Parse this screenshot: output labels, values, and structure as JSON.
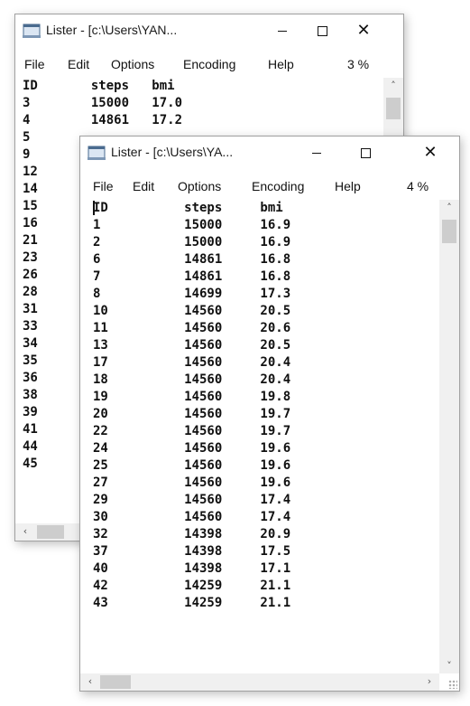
{
  "back_window": {
    "title": "Lister - [c:\\Users\\YAN...",
    "menu": {
      "file": "File",
      "edit": "Edit",
      "options": "Options",
      "encoding": "Encoding",
      "help": "Help",
      "percent": "3 %"
    },
    "text": "ID       steps   bmi\n3        15000   17.0\n4        14861   17.2\n5\n9\n12\n14\n15\n16\n21\n23\n26\n28\n31\n33\n34\n35\n36\n38\n39\n41\n44\n45"
  },
  "front_window": {
    "title": "Lister - [c:\\Users\\YA...",
    "menu": {
      "file": "File",
      "edit": "Edit",
      "options": "Options",
      "encoding": "Encoding",
      "help": "Help",
      "percent": "4 %"
    },
    "text": "ID          steps     bmi\n1           15000     16.9\n2           15000     16.9\n6           14861     16.8\n7           14861     16.8\n8           14699     17.3\n10          14560     20.5\n11          14560     20.6\n13          14560     20.5\n17          14560     20.4\n18          14560     20.4\n19          14560     19.8\n20          14560     19.7\n22          14560     19.7\n24          14560     19.6\n25          14560     19.6\n27          14560     19.6\n29          14560     17.4\n30          14560     17.4\n32          14398     20.9\n37          14398     17.5\n40          14398     17.1\n42          14259     21.1\n43          14259     21.1"
  },
  "icons": {
    "app": "lister-window-icon",
    "minimize": "minimize-icon",
    "maximize": "maximize-icon",
    "close": "close-icon"
  }
}
